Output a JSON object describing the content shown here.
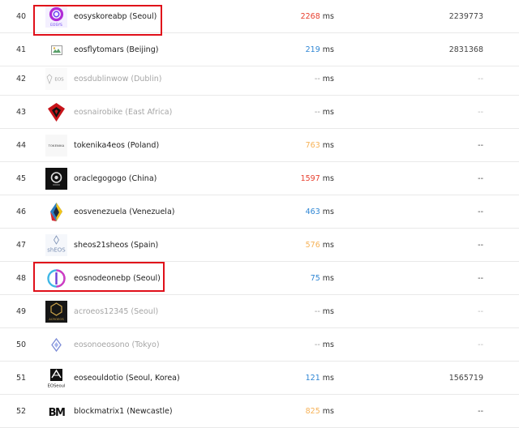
{
  "colors": {
    "latency_red": "#e8402f",
    "latency_blue": "#2f86d4",
    "latency_orange": "#f6b257",
    "highlight_border": "#e0101a"
  },
  "producers": [
    {
      "rank": "40",
      "name": "eosyskoreabp (Seoul)",
      "latency": "2268",
      "latency_color": "red",
      "unit": "ms",
      "block": "2239773",
      "active": true,
      "logo": "eosys-logo",
      "logo_text": "EOSYS",
      "highlighted": true
    },
    {
      "rank": "41",
      "name": "eosflytomars (Beijing)",
      "latency": "219",
      "latency_color": "blue",
      "unit": "ms",
      "block": "2831368",
      "active": true,
      "logo": "broken-image-icon",
      "logo_text": ""
    },
    {
      "rank": "42",
      "name": "eosdublinwow (Dublin)",
      "latency": "--",
      "latency_color": "gray",
      "unit": "ms",
      "block": "--",
      "active": false,
      "logo": "eos-dublin-logo",
      "logo_text": "EOS"
    },
    {
      "rank": "43",
      "name": "eosnairobike (East Africa)",
      "latency": "--",
      "latency_color": "gray",
      "unit": "ms",
      "block": "--",
      "active": false,
      "logo": "nairobi-shield-logo",
      "logo_text": ""
    },
    {
      "rank": "44",
      "name": "tokenika4eos (Poland)",
      "latency": "763",
      "latency_color": "orange",
      "unit": "ms",
      "block": "--",
      "active": true,
      "logo": "tokenika-logo",
      "logo_text": "TOKENIKA"
    },
    {
      "rank": "45",
      "name": "oraclegogogo (China)",
      "latency": "1597",
      "latency_color": "red",
      "unit": "ms",
      "block": "--",
      "active": true,
      "logo": "oracle-circle-logo",
      "logo_text": ""
    },
    {
      "rank": "46",
      "name": "eosvenezuela (Venezuela)",
      "latency": "463",
      "latency_color": "blue",
      "unit": "ms",
      "block": "--",
      "active": true,
      "logo": "eos-venezuela-logo",
      "logo_text": ""
    },
    {
      "rank": "47",
      "name": "sheos21sheos (Spain)",
      "latency": "576",
      "latency_color": "orange",
      "unit": "ms",
      "block": "--",
      "active": true,
      "logo": "sheos-logo",
      "logo_text": "shEOS"
    },
    {
      "rank": "48",
      "name": "eosnodeonebp (Seoul)",
      "latency": "75",
      "latency_color": "blue",
      "unit": "ms",
      "block": "--",
      "active": true,
      "logo": "eosnodeone-logo",
      "logo_text": "",
      "highlighted": true
    },
    {
      "rank": "49",
      "name": "acroeos12345 (Seoul)",
      "latency": "--",
      "latency_color": "gray",
      "unit": "ms",
      "block": "--",
      "active": false,
      "logo": "acroeos-logo",
      "logo_text": "ACROEOS"
    },
    {
      "rank": "50",
      "name": "eosonoeosono (Tokyo)",
      "latency": "--",
      "latency_color": "gray",
      "unit": "ms",
      "block": "--",
      "active": false,
      "logo": "eosono-diamond-logo",
      "logo_text": ""
    },
    {
      "rank": "51",
      "name": "eoseouldotio (Seoul, Korea)",
      "latency": "121",
      "latency_color": "blue",
      "unit": "ms",
      "block": "1565719",
      "active": true,
      "logo": "eoseoul-logo",
      "logo_text": "EOSeoul"
    },
    {
      "rank": "52",
      "name": "blockmatrix1 (Newcastle)",
      "latency": "825",
      "latency_color": "orange",
      "unit": "ms",
      "block": "--",
      "active": true,
      "logo": "blockmatrix-logo",
      "logo_text": "BM"
    }
  ]
}
